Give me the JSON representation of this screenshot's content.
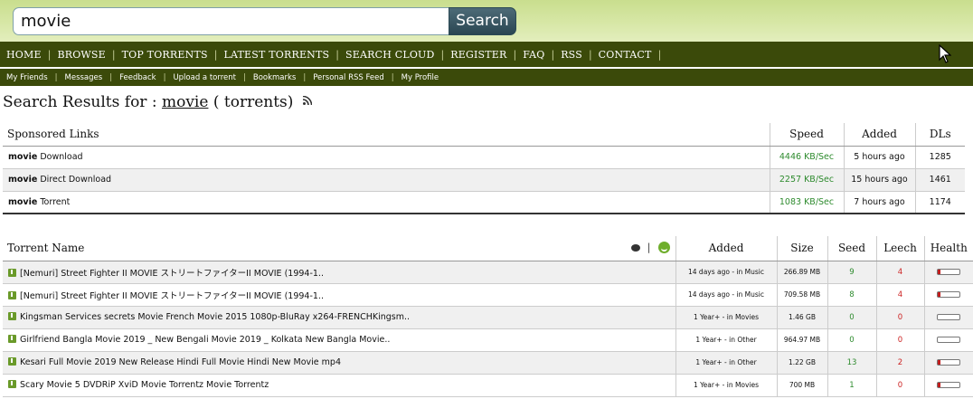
{
  "search": {
    "value": "movie",
    "button": "Search"
  },
  "nav": [
    "HOME",
    "BROWSE",
    "TOP TORRENTS",
    "LATEST TORRENTS",
    "SEARCH CLOUD",
    "REGISTER",
    "FAQ",
    "RSS",
    "CONTACT"
  ],
  "subnav": [
    "My Friends",
    "Messages",
    "Feedback",
    "Upload a torrent",
    "Bookmarks",
    "Personal RSS Feed",
    "My Profile"
  ],
  "results": {
    "prefix": "Search Results for :",
    "query": "movie",
    "suffix": "( torrents)"
  },
  "sponsored": {
    "headers": {
      "name": "Sponsored Links",
      "speed": "Speed",
      "added": "Added",
      "dls": "DLs"
    },
    "rows": [
      {
        "bold": "movie",
        "rest": "Download",
        "speed": "4446 KB/Sec",
        "added": "5 hours ago",
        "dls": "1285"
      },
      {
        "bold": "movie",
        "rest": "Direct Download",
        "speed": "2257 KB/Sec",
        "added": "15 hours ago",
        "dls": "1461"
      },
      {
        "bold": "movie",
        "rest": "Torrent",
        "speed": "1083 KB/Sec",
        "added": "7 hours ago",
        "dls": "1174"
      }
    ]
  },
  "torrents": {
    "headers": {
      "name": "Torrent Name",
      "added": "Added",
      "size": "Size",
      "seed": "Seed",
      "leech": "Leech",
      "health": "Health"
    },
    "rows": [
      {
        "name": "[Nemuri] Street Fighter II MOVIE ストリートファイターII MOVIE (1994-1..",
        "added": "14 days ago - in Music",
        "size": "266.89 MB",
        "seed": "9",
        "leech": "4",
        "health": 0.1
      },
      {
        "name": "[Nemuri] Street Fighter II MOVIE ストリートファイターII MOVIE (1994-1..",
        "added": "14 days ago - in Music",
        "size": "709.58 MB",
        "seed": "8",
        "leech": "4",
        "health": 0.1
      },
      {
        "name": "Kingsman Services secrets Movie French Movie 2015 1080p-BluRay x264-FRENCHKingsm..",
        "added": "1 Year+ - in Movies",
        "size": "1.46 GB",
        "seed": "0",
        "leech": "0",
        "health": 0
      },
      {
        "name": "Girlfriend Bangla Movie 2019 _ New Bengali Movie 2019 _ Kolkata New Bangla Movie..",
        "added": "1 Year+ - in Other",
        "size": "964.97 MB",
        "seed": "0",
        "leech": "0",
        "health": 0
      },
      {
        "name": "Kesari Full Movie 2019 New Release Hindi Full Movie Hindi New Movie mp4",
        "added": "1 Year+ - in Other",
        "size": "1.22 GB",
        "seed": "13",
        "leech": "2",
        "health": 0.1
      },
      {
        "name": "Scary Movie 5 DVDRiP XviD Movie Torrentz Movie Torrentz",
        "added": "1 Year+ - in Movies",
        "size": "700 MB",
        "seed": "1",
        "leech": "0",
        "health": 0.1
      }
    ]
  }
}
